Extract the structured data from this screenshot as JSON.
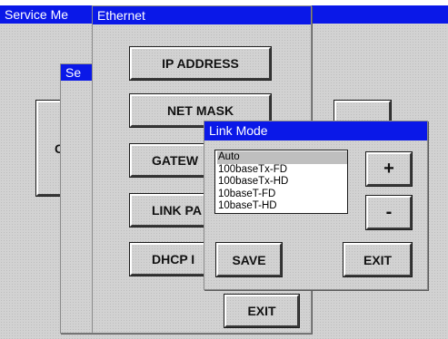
{
  "windows": {
    "service_menu": {
      "title": "Service Me",
      "button_partial": "C"
    },
    "second": {
      "title": "Se"
    },
    "ethernet": {
      "title": "Ethernet",
      "buttons": [
        "IP ADDRESS",
        "NET MASK",
        "GATEW",
        "LINK PA",
        "DHCP I"
      ],
      "exit_label": "EXIT"
    },
    "link_mode": {
      "title": "Link Mode",
      "options": [
        "Auto",
        "100baseTx-FD",
        "100baseTx-HD",
        "10baseT-FD",
        "10baseT-HD"
      ],
      "selected": "Auto",
      "plus_label": "+",
      "minus_label": "-",
      "save_label": "SAVE",
      "exit_label": "EXIT"
    }
  },
  "colors": {
    "titlebar": "#0a18e8",
    "panel": "#d2d2d2"
  }
}
